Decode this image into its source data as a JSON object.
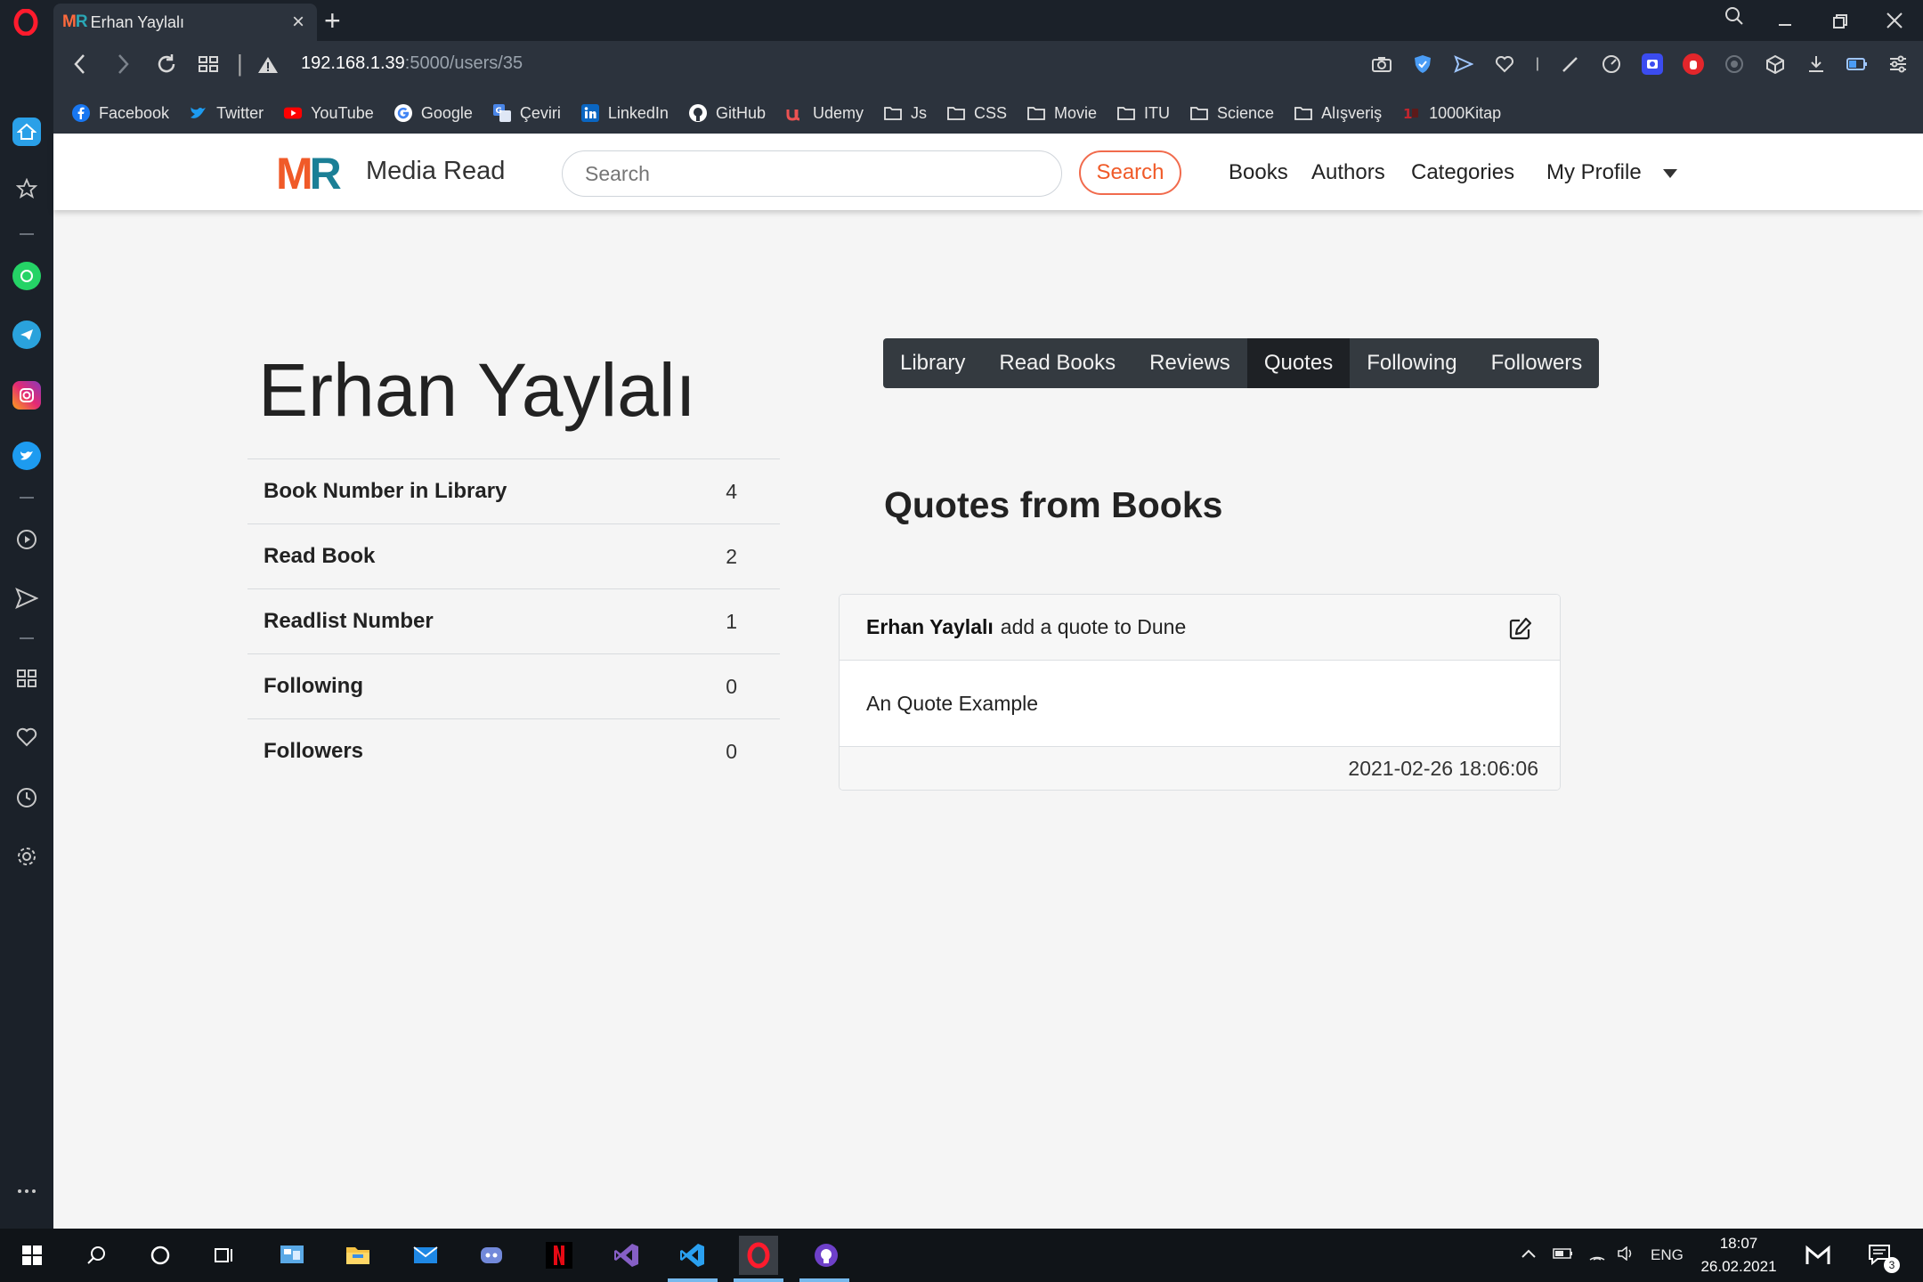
{
  "browser": {
    "tab_title": "Erhan Yaylalı",
    "tab_favicon": "MR",
    "url_host": "192.168.1.39",
    "url_path": ":5000/users/35",
    "bookmarks": [
      {
        "label": "Facebook",
        "icon": "facebook-icon",
        "color": "#1877f2"
      },
      {
        "label": "Twitter",
        "icon": "twitter-icon",
        "color": "#1d9bf0"
      },
      {
        "label": "YouTube",
        "icon": "youtube-icon",
        "color": "#ff0000"
      },
      {
        "label": "Google",
        "icon": "google-icon",
        "color": "#ffffff"
      },
      {
        "label": "Çeviri",
        "icon": "translate-icon",
        "color": "#4a86e8"
      },
      {
        "label": "LinkedIn",
        "icon": "linkedin-icon",
        "color": "#0a66c2"
      },
      {
        "label": "GitHub",
        "icon": "github-icon",
        "color": "#ffffff"
      },
      {
        "label": "Udemy",
        "icon": "udemy-icon",
        "color": "#ec5252"
      },
      {
        "label": "Js",
        "icon": "folder-icon",
        "color": "#e4e4e4"
      },
      {
        "label": "CSS",
        "icon": "folder-icon",
        "color": "#e4e4e4"
      },
      {
        "label": "Movie",
        "icon": "folder-icon",
        "color": "#e4e4e4"
      },
      {
        "label": "ITU",
        "icon": "folder-icon",
        "color": "#e4e4e4"
      },
      {
        "label": "Science",
        "icon": "folder-icon",
        "color": "#e4e4e4"
      },
      {
        "label": "Alışveriş",
        "icon": "folder-icon",
        "color": "#e4e4e4"
      },
      {
        "label": "1000Kitap",
        "icon": "1000kitap-icon",
        "color": "#c4262e"
      }
    ]
  },
  "navbar": {
    "logo_m": "M",
    "logo_r": "R",
    "brand": "Media Read",
    "search_placeholder": "Search",
    "search_button": "Search",
    "links": [
      "Books",
      "Authors",
      "Categories"
    ],
    "profile_label": "My Profile"
  },
  "profile": {
    "name": "Erhan Yaylalı",
    "stats": [
      {
        "label": "Book Number in Library",
        "value": "4"
      },
      {
        "label": "Read Book",
        "value": "2"
      },
      {
        "label": "Readlist Number",
        "value": "1"
      },
      {
        "label": "Following",
        "value": "0"
      },
      {
        "label": "Followers",
        "value": "0"
      }
    ],
    "tabs": [
      "Library",
      "Read Books",
      "Reviews",
      "Quotes",
      "Following",
      "Followers"
    ],
    "active_tab": "Quotes",
    "section_title": "Quotes from Books",
    "quote": {
      "author": "Erhan Yaylalı",
      "action": "add a quote to Dune",
      "text": "An Quote Example",
      "timestamp": "2021-02-26 18:06:06"
    }
  },
  "taskbar": {
    "language": "ENG",
    "time": "18:07",
    "date": "26.02.2021",
    "notification_count": "3"
  },
  "colors": {
    "brand_orange": "#f05a28",
    "brand_teal": "#1b7f96",
    "tabs_bg": "#343a40",
    "active_tab_bg": "#1e2125"
  }
}
